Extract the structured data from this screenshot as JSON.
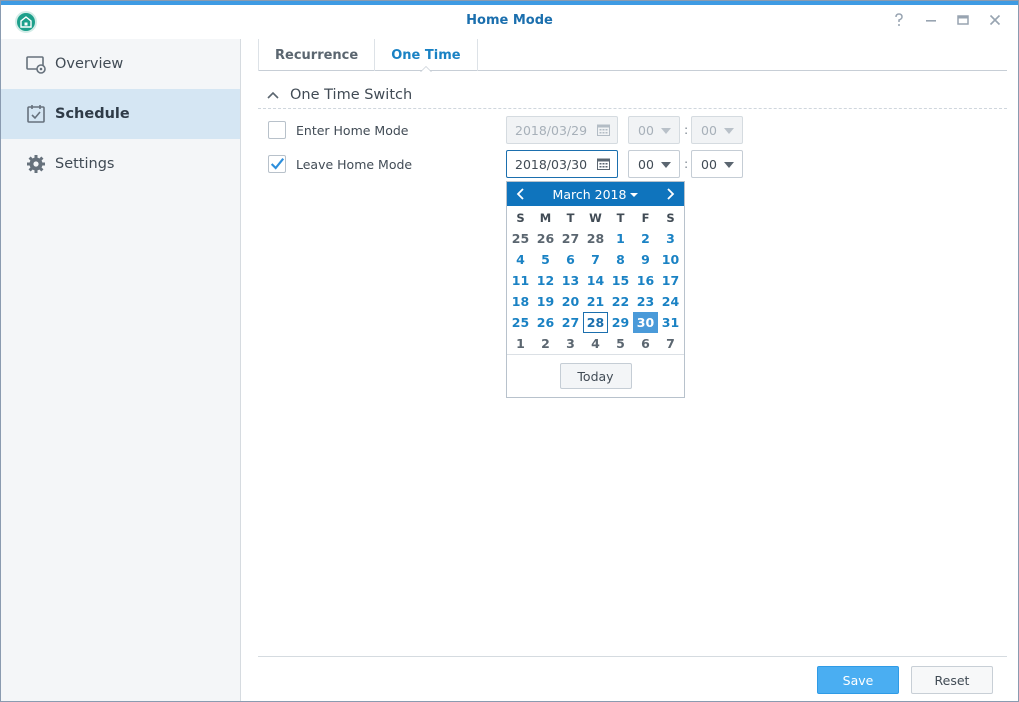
{
  "window": {
    "title": "Home Mode",
    "accent": "#3e9be3",
    "controls": [
      "help-icon",
      "minimize-icon",
      "maximize-icon",
      "close-icon"
    ]
  },
  "sidebar": {
    "items": [
      {
        "label": "Overview",
        "icon": "overview-icon",
        "active": false
      },
      {
        "label": "Schedule",
        "icon": "calendar-check-icon",
        "active": true
      },
      {
        "label": "Settings",
        "icon": "gear-icon",
        "active": false
      }
    ]
  },
  "tabs": [
    {
      "label": "Recurrence",
      "active": false
    },
    {
      "label": "One Time",
      "active": true
    }
  ],
  "section": {
    "title": "One Time Switch",
    "enter": {
      "label": "Enter Home Mode",
      "checked": false,
      "date": "2018/03/29",
      "hour": "00",
      "minute": "00",
      "disabled": true
    },
    "leave": {
      "label": "Leave Home Mode",
      "checked": true,
      "date": "2018/03/30",
      "hour": "00",
      "minute": "00",
      "disabled": false
    },
    "time_separator": ":"
  },
  "calendar": {
    "month_label": "March 2018",
    "weekdays": [
      "S",
      "M",
      "T",
      "W",
      "T",
      "F",
      "S"
    ],
    "weeks": [
      [
        "25",
        "26",
        "27",
        "28",
        "1",
        "2",
        "3"
      ],
      [
        "4",
        "5",
        "6",
        "7",
        "8",
        "9",
        "10"
      ],
      [
        "11",
        "12",
        "13",
        "14",
        "15",
        "16",
        "17"
      ],
      [
        "18",
        "19",
        "20",
        "21",
        "22",
        "23",
        "24"
      ],
      [
        "25",
        "26",
        "27",
        "28",
        "29",
        "30",
        "31"
      ],
      [
        "1",
        "2",
        "3",
        "4",
        "5",
        "6",
        "7"
      ]
    ],
    "today_button": "Today",
    "today_day": "28",
    "selected_day": "30"
  },
  "footer": {
    "save_label": "Save",
    "reset_label": "Reset"
  }
}
